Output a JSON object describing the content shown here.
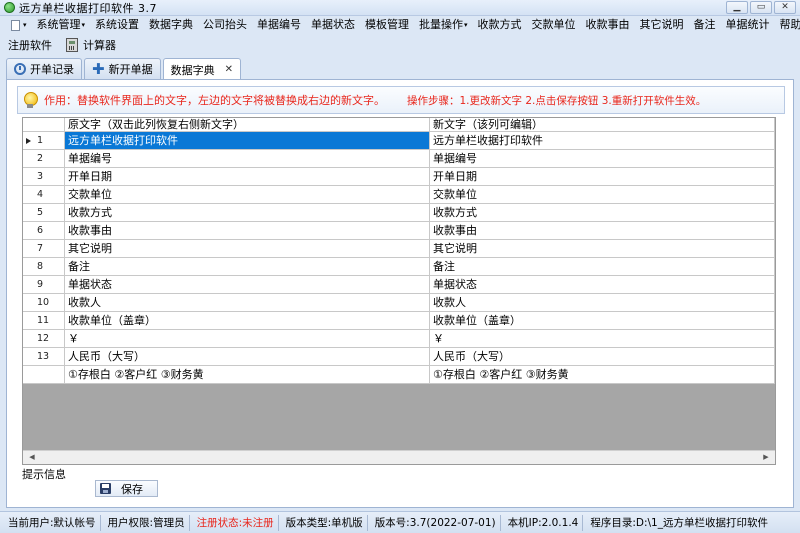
{
  "window": {
    "title": "远方单栏收据打印软件 3.7",
    "buttons": [
      "▁",
      "▭",
      "✕"
    ]
  },
  "menu": {
    "items": [
      {
        "label": "系统管理",
        "caret": true
      },
      {
        "label": "系统设置",
        "caret": false
      },
      {
        "label": "数据字典",
        "caret": false
      },
      {
        "label": "公司抬头",
        "caret": false
      },
      {
        "label": "单据编号",
        "caret": false
      },
      {
        "label": "单据状态",
        "caret": false
      },
      {
        "label": "模板管理",
        "caret": false
      },
      {
        "label": "批量操作",
        "caret": true
      },
      {
        "label": "收款方式",
        "caret": false
      },
      {
        "label": "交款单位",
        "caret": false
      },
      {
        "label": "收款事由",
        "caret": false
      },
      {
        "label": "其它说明",
        "caret": false
      },
      {
        "label": "备注",
        "caret": false
      },
      {
        "label": "单据统计",
        "caret": false
      },
      {
        "label": "帮助",
        "caret": true
      }
    ]
  },
  "toolbar": {
    "register_label": "注册软件",
    "calculator_label": "计算器"
  },
  "tabs": [
    {
      "label": "开单记录",
      "icon": "history-icon",
      "active": false
    },
    {
      "label": "新开单据",
      "icon": "plus-icon",
      "active": false
    },
    {
      "label": "数据字典",
      "icon": "",
      "active": true,
      "closable": true
    }
  ],
  "hint": {
    "text": "作用：替换软件界面上的文字，左边的文字将被替换成右边的新文字。",
    "steps": "操作步骤：1.更改新文字  2.点击保存按钮  3.重新打开软件生效。"
  },
  "grid": {
    "headers": {
      "original": "原文字（双击此列恢复右侧新文字）",
      "new": "新文字（该列可编辑）"
    },
    "rows": [
      {
        "num": "1",
        "original": "远方单栏收据打印软件",
        "new": "远方单栏收据打印软件",
        "current": true
      },
      {
        "num": "2",
        "original": "单据编号",
        "new": "单据编号"
      },
      {
        "num": "3",
        "original": "开单日期",
        "new": "开单日期"
      },
      {
        "num": "4",
        "original": "交款单位",
        "new": "交款单位"
      },
      {
        "num": "5",
        "original": "收款方式",
        "new": "收款方式"
      },
      {
        "num": "6",
        "original": "收款事由",
        "new": "收款事由"
      },
      {
        "num": "7",
        "original": "其它说明",
        "new": "其它说明"
      },
      {
        "num": "8",
        "original": "备注",
        "new": "备注"
      },
      {
        "num": "9",
        "original": "单据状态",
        "new": "单据状态"
      },
      {
        "num": "10",
        "original": "收款人",
        "new": "收款人"
      },
      {
        "num": "11",
        "original": "收款单位（盖章）",
        "new": "收款单位（盖章）"
      },
      {
        "num": "12",
        "original": "￥",
        "new": "￥"
      },
      {
        "num": "13",
        "original": "人民币（大写）",
        "new": "人民币（大写）"
      },
      {
        "num": "",
        "original": "①存根白 ②客户红 ③财务黄",
        "new": "①存根白 ②客户红 ③财务黄"
      }
    ]
  },
  "status_label": "提示信息",
  "save_label": "保存",
  "statusbar": {
    "segments": [
      {
        "text": "当前用户:默认帐号",
        "color": "#000000"
      },
      {
        "text": "用户权限:管理员",
        "color": "#000000"
      },
      {
        "text": "注册状态:未注册",
        "color": "#e8261c"
      },
      {
        "text": "版本类型:单机版",
        "color": "#000000"
      },
      {
        "text": "版本号:3.7(2022-07-01)",
        "color": "#000000"
      },
      {
        "text": "本机IP:2.0.1.4",
        "color": "#000000"
      },
      {
        "text": "程序目录:D:\\1_远方单栏收据打印软件",
        "color": "#000000"
      }
    ]
  },
  "colors": {
    "accent": "#0a78d6",
    "hint_red": "#e8261c",
    "window_bg": "#dce7f5"
  }
}
